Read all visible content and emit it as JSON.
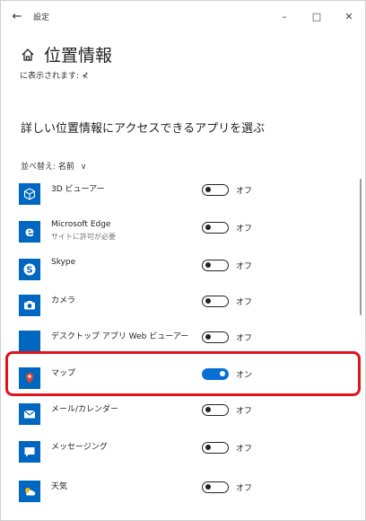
{
  "window": {
    "title": "設定",
    "back_glyph": "←",
    "min_glyph": "–",
    "max_glyph": "□",
    "close_glyph": "✕"
  },
  "header": {
    "title": "位置情報",
    "icon": "home-icon"
  },
  "subtext": "に表示されます: ⊀",
  "section": {
    "heading": "詳しい位置情報にアクセスできるアプリを選ぶ"
  },
  "sort": {
    "label": "並べ替え:",
    "value": "名前",
    "chevron": "∨"
  },
  "apps": [
    {
      "name": "3D ビューアー",
      "sub": "",
      "state": "オフ",
      "on": false,
      "icon": "cube-icon",
      "color": "#0067c0"
    },
    {
      "name": "Microsoft Edge",
      "sub": "サイトに許可が必要",
      "state": "オフ",
      "on": false,
      "icon": "edge-icon",
      "color": "#0067c0"
    },
    {
      "name": "Skype",
      "sub": "",
      "state": "オフ",
      "on": false,
      "icon": "skype-icon",
      "color": "#0067c0"
    },
    {
      "name": "カメラ",
      "sub": "",
      "state": "オフ",
      "on": false,
      "icon": "camera-icon",
      "color": "#0067c0"
    },
    {
      "name": "デスクトップ アプリ Web ビューアー",
      "sub": "",
      "state": "オフ",
      "on": false,
      "icon": "web-viewer-icon",
      "color": "#0067c0"
    },
    {
      "name": "マップ",
      "sub": "",
      "state": "オン",
      "on": true,
      "icon": "maps-icon",
      "color": "#0067c0"
    },
    {
      "name": "メール/カレンダー",
      "sub": "",
      "state": "オフ",
      "on": false,
      "icon": "mail-icon",
      "color": "#0067c0"
    },
    {
      "name": "メッセージング",
      "sub": "",
      "state": "オフ",
      "on": false,
      "icon": "messaging-icon",
      "color": "#0067c0"
    },
    {
      "name": "天気",
      "sub": "",
      "state": "オフ",
      "on": false,
      "icon": "weather-icon",
      "color": "#0067c0"
    }
  ],
  "accent": "#0a6fd4",
  "highlight_color": "#e0141a"
}
